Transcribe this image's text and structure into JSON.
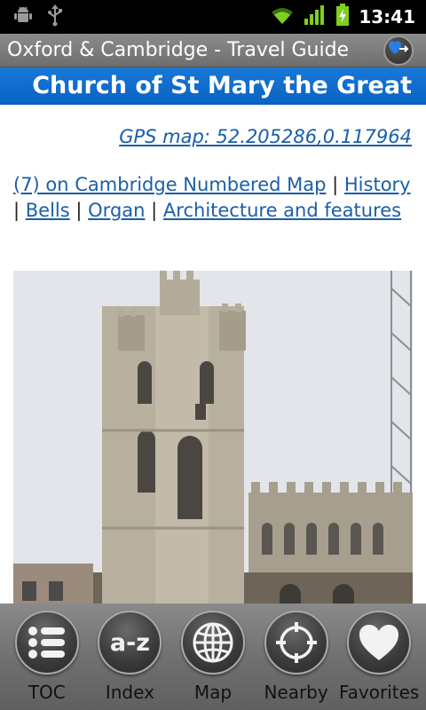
{
  "status_bar": {
    "time": "13:41",
    "icons": [
      "android-debug-icon",
      "usb-icon",
      "wifi-icon",
      "signal-icon",
      "battery-charging-icon"
    ]
  },
  "app": {
    "title": "Oxford & Cambridge - Travel Guide"
  },
  "page": {
    "heading": "Church of St Mary the Great",
    "gps_link": "GPS map: 52.205286,0.117964",
    "links": [
      {
        "label": "(7) on Cambridge Numbered Map"
      },
      {
        "label": "History"
      },
      {
        "label": "Bells"
      },
      {
        "label": "Organ"
      },
      {
        "label": "Architecture and features"
      }
    ],
    "separator": "|"
  },
  "toolbar": {
    "buttons": [
      {
        "label": "TOC",
        "icon": "list-icon"
      },
      {
        "label": "Index",
        "icon": "a-z-icon",
        "icon_text": "a-z"
      },
      {
        "label": "Map",
        "icon": "globe-icon"
      },
      {
        "label": "Nearby",
        "icon": "crosshair-icon"
      },
      {
        "label": "Favorites",
        "icon": "heart-icon"
      }
    ]
  },
  "colors": {
    "heading_bg": "#0a6ed0",
    "link": "#1a5fa8",
    "title_bar": "#7d7d7d"
  }
}
